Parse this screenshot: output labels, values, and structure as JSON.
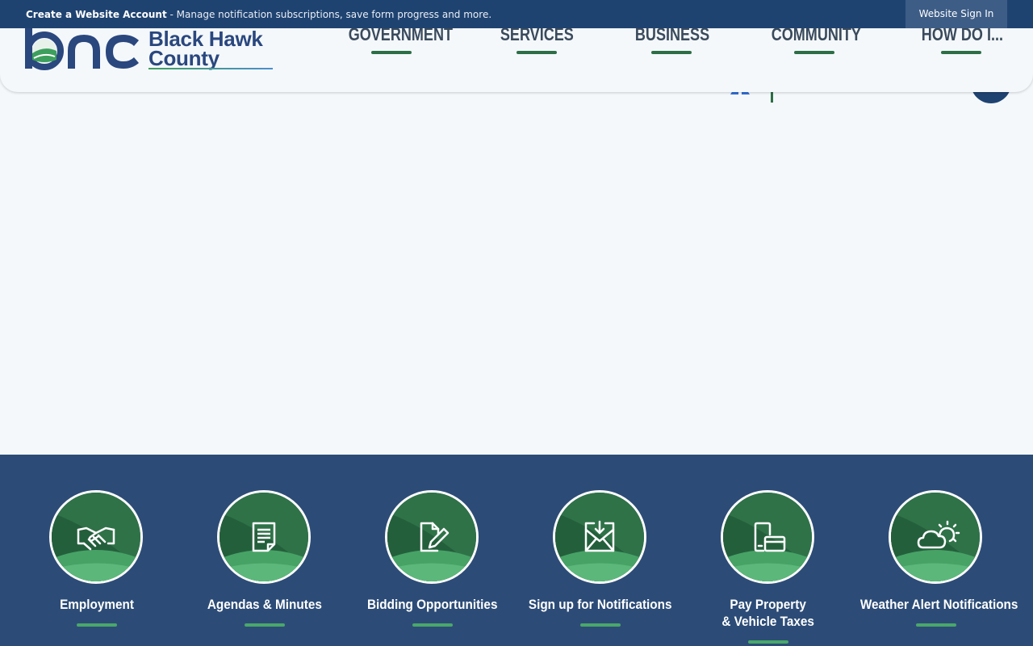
{
  "topbar": {
    "create_label": "Create a Website Account",
    "create_desc": " - Manage notification subscriptions, save form progress and more.",
    "signin_label": "Website Sign In",
    "bg_color": "#1f4371"
  },
  "header": {
    "logo": {
      "mark_text": "bhc",
      "line1": "Black Hawk",
      "line2": "County"
    },
    "nav": [
      "GOVERNMENT",
      "SERVICES",
      "BUSINESS",
      "COMMUNITY",
      "HOW DO I..."
    ]
  },
  "quicklinks": {
    "bg_color": "#2c4c77",
    "accent_color": "#4aa86a",
    "items": [
      {
        "title": "Employment",
        "icon": "handshake-icon"
      },
      {
        "title": "Agendas & Minutes",
        "icon": "document-icon"
      },
      {
        "title": "Bidding Opportunities",
        "icon": "document-edit-icon"
      },
      {
        "title": "Sign up for Notifications",
        "icon": "envelope-icon"
      },
      {
        "title": "Pay Property\n& Vehicle Taxes",
        "icon": "payment-icon"
      },
      {
        "title": "Weather Alert Notifications",
        "icon": "weather-icon"
      }
    ]
  }
}
